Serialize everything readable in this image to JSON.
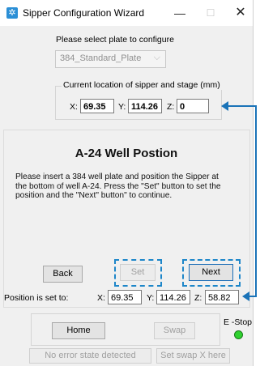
{
  "window": {
    "title": "Sipper Configuration Wizard",
    "icon": "gear-icon",
    "min_glyph": "—",
    "max_glyph": "☐",
    "close_glyph": "✕"
  },
  "plate": {
    "prompt": "Please select plate to configure",
    "selected": "384_Standard_Plate"
  },
  "current_location": {
    "title": "Current location of sipper and stage (mm)",
    "x_label": "X:",
    "x_value": "69.35",
    "y_label": "Y:",
    "y_value": "114.26",
    "z_label": "Z:",
    "z_value": "0"
  },
  "step": {
    "heading": "A-24 Well Postion",
    "instructions": "Please insert a 384 well plate and position the Sipper at the bottom of well A-24. Press the \"Set\" button to set the position and the \"Next\" button\" to continue."
  },
  "buttons": {
    "back": "Back",
    "set": "Set",
    "next": "Next",
    "home": "Home",
    "swap": "Swap",
    "set_swap": "Set swap X here"
  },
  "position_set": {
    "label": "Position is set to:",
    "x_label": "X:",
    "x_value": "69.35",
    "y_label": "Y:",
    "y_value": "114.26",
    "z_label": "Z:",
    "z_value": "58.82"
  },
  "estop": {
    "label": "E -Stop",
    "status_color": "#2fd12f"
  },
  "status": {
    "error": "No error state detected"
  },
  "annotation_color": "#1a73b8"
}
